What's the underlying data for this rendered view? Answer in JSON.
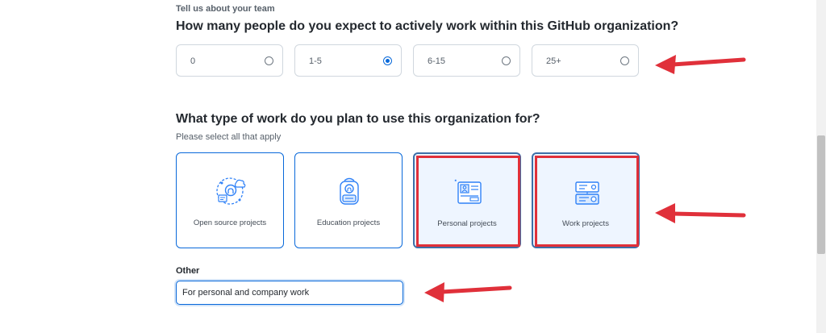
{
  "header": {
    "section_label": "Tell us about your team"
  },
  "team_size": {
    "question": "How many people do you expect to actively work within this GitHub organization?",
    "options": [
      {
        "label": "0",
        "checked": false
      },
      {
        "label": "1-5",
        "checked": true
      },
      {
        "label": "6-15",
        "checked": false
      },
      {
        "label": "25+",
        "checked": false
      }
    ]
  },
  "work_type": {
    "question": "What type of work do you plan to use this organization for?",
    "hint": "Please select all that apply",
    "options": [
      {
        "label": "Open source projects",
        "icon": "open-source-icon",
        "selected": false
      },
      {
        "label": "Education projects",
        "icon": "backpack-icon",
        "selected": false
      },
      {
        "label": "Personal projects",
        "icon": "personal-profile-icon",
        "selected": true
      },
      {
        "label": "Work projects",
        "icon": "work-briefcase-icon",
        "selected": true
      }
    ]
  },
  "other": {
    "label": "Other",
    "value": "For personal and company work"
  },
  "colors": {
    "accent": "#0969da",
    "annotation": "#e0303a",
    "selected_bg": "#eef5ff"
  }
}
